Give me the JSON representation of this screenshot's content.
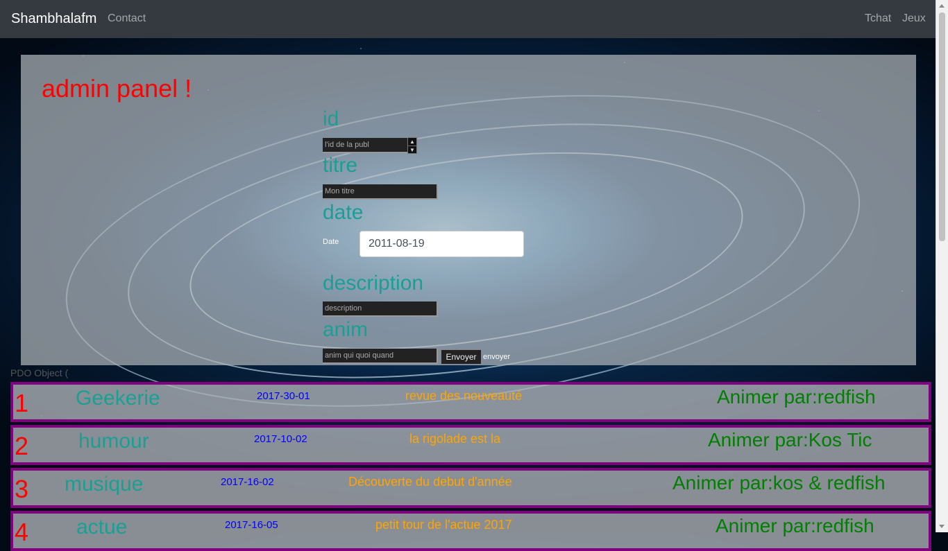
{
  "navbar": {
    "brand": "Shambhalafm",
    "links": [
      "Contact",
      "Tchat",
      "Jeux"
    ]
  },
  "panel": {
    "title": "admin panel !",
    "fields": {
      "id": {
        "label": "id",
        "placeholder": "l'id de la publ"
      },
      "titre": {
        "label": "titre",
        "placeholder": "Mon titre"
      },
      "date": {
        "label": "date",
        "caption": "Date",
        "value": "2011-08-19"
      },
      "description": {
        "label": "description",
        "placeholder": "description"
      },
      "anim": {
        "label": "anim",
        "placeholder": "anim qui quoi quand"
      }
    },
    "submit_label": "Envoyer",
    "submit_note": "envoyer"
  },
  "pdo_label": "PDO Object (",
  "rows": [
    {
      "num": "1",
      "category": "Geekerie",
      "date": "2017-30-01",
      "description": "revue des nouveauté",
      "anim": "Animer par:redfish"
    },
    {
      "num": "2",
      "category": "humour",
      "date": "2017-10-02",
      "description": "la rigolade est la",
      "anim": "Animer par:Kos Tic"
    },
    {
      "num": "3",
      "category": "musique",
      "date": "2017-16-02",
      "description": "Découverte du debut d'année",
      "anim": "Animer par:kos & redfish"
    },
    {
      "num": "4",
      "category": "actue",
      "date": "2017-16-05",
      "description": "petit tour de l'actue 2017",
      "anim": "Animer par:redfish"
    }
  ],
  "colors": {
    "navbar_bg": "#343a40",
    "title": "#ff0000",
    "label": "#19a094",
    "row_border": "#800080",
    "date": "#0000ff",
    "description": "#ffa500",
    "anim": "#008000"
  }
}
